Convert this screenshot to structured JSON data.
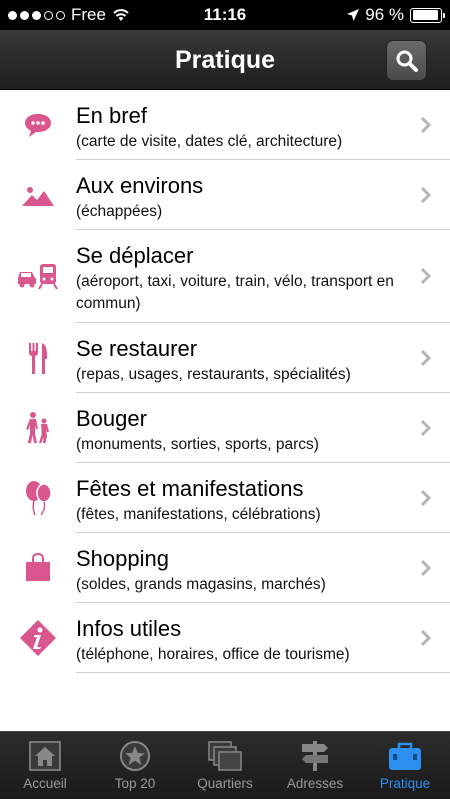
{
  "status": {
    "carrier": "Free",
    "time": "11:16",
    "battery": "96 %",
    "battery_level": 0.96,
    "signal_bars": 3
  },
  "header": {
    "title": "Pratique"
  },
  "items": [
    {
      "title": "En bref",
      "subtitle": "(carte de visite, dates clé, architecture)",
      "icon": "speech-bubble-icon"
    },
    {
      "title": "Aux environs",
      "subtitle": "(échappées)",
      "icon": "mountains-icon"
    },
    {
      "title": "Se déplacer",
      "subtitle": "(aéroport, taxi, voiture, train, vélo, transport en commun)",
      "icon": "car-train-icon"
    },
    {
      "title": "Se restaurer",
      "subtitle": "(repas, usages, restaurants, spécialités)",
      "icon": "fork-knife-icon"
    },
    {
      "title": "Bouger",
      "subtitle": "(monuments, sorties, sports, parcs)",
      "icon": "walking-people-icon"
    },
    {
      "title": "Fêtes et manifestations",
      "subtitle": "(fêtes, manifestations, célébrations)",
      "icon": "balloons-icon"
    },
    {
      "title": "Shopping",
      "subtitle": "(soldes, grands magasins, marchés)",
      "icon": "shopping-bag-icon"
    },
    {
      "title": "Infos utiles",
      "subtitle": "(téléphone, horaires, office de tourisme)",
      "icon": "info-icon"
    }
  ],
  "tabs": [
    {
      "label": "Accueil",
      "icon": "home-icon"
    },
    {
      "label": "Top 20",
      "icon": "star-icon"
    },
    {
      "label": "Quartiers",
      "icon": "map-icon"
    },
    {
      "label": "Adresses",
      "icon": "signpost-icon"
    },
    {
      "label": "Pratique",
      "icon": "suitcase-icon"
    }
  ],
  "colors": {
    "accent": "#d9568f",
    "tab_active": "#2d8ff0"
  }
}
